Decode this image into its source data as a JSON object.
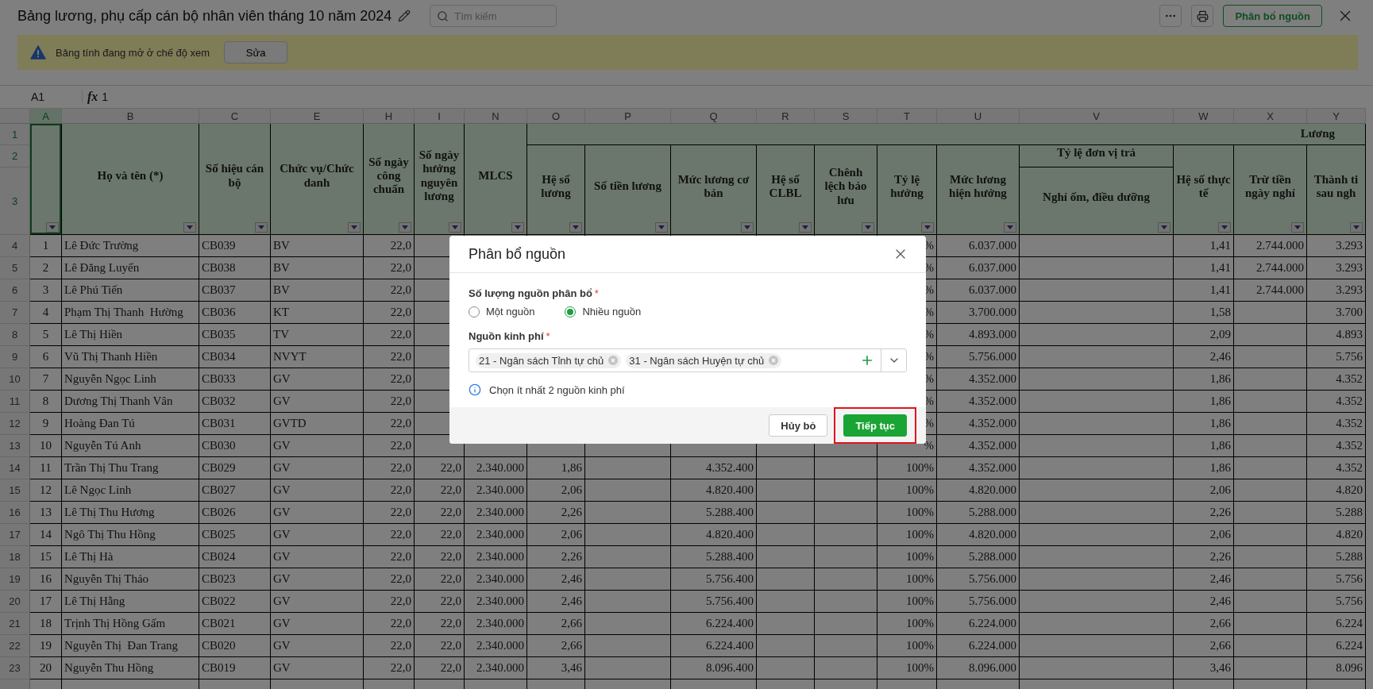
{
  "topbar": {
    "title": "Bảng lương, phụ cấp cán bộ nhân viên tháng 10 năm 2024",
    "search": {
      "placeholder": "Tìm kiếm"
    },
    "primary_button": "Phân bổ nguồn"
  },
  "banner": {
    "message": "Bảng tính đang mở ở chế độ xem",
    "button": "Sửa"
  },
  "formula_bar": {
    "cell_ref": "A1",
    "fx_label": "fx",
    "value": "1"
  },
  "sheet": {
    "band_title": "Lương",
    "header_rows": [
      {
        "label": "1",
        "selected": true
      },
      {
        "label": "2",
        "selected": true
      },
      {
        "label": "3",
        "selected": true
      }
    ],
    "columns": [
      {
        "letter": "A",
        "selected": true,
        "kind": "index",
        "banded": false
      },
      {
        "letter": "B",
        "selected": false,
        "kind": "text",
        "banded": false,
        "title": "Họ và tên (*)"
      },
      {
        "letter": "C",
        "selected": false,
        "kind": "text",
        "banded": false,
        "title": "Số hiệu cán bộ"
      },
      {
        "letter": "E",
        "selected": false,
        "kind": "text",
        "banded": false,
        "title": "Chức vụ/Chức danh"
      },
      {
        "letter": "H",
        "selected": false,
        "kind": "number",
        "banded": false,
        "title": "Số ngày công chuẩn"
      },
      {
        "letter": "I",
        "selected": false,
        "kind": "number",
        "banded": false,
        "title": "Số ngày hưởng nguyên lương"
      },
      {
        "letter": "N",
        "selected": false,
        "kind": "number",
        "banded": false,
        "title": "MLCS"
      },
      {
        "letter": "O",
        "selected": false,
        "kind": "number",
        "banded": true,
        "title": "Hệ số lương"
      },
      {
        "letter": "P",
        "selected": false,
        "kind": "number",
        "banded": true,
        "title": "Số tiền lương"
      },
      {
        "letter": "Q",
        "selected": false,
        "kind": "number",
        "banded": true,
        "title": "Mức lương cơ bản"
      },
      {
        "letter": "R",
        "selected": false,
        "kind": "number",
        "banded": true,
        "title": "Hệ số CLBL"
      },
      {
        "letter": "S",
        "selected": false,
        "kind": "number",
        "banded": true,
        "title": "Chênh lệch bảo lưu"
      },
      {
        "letter": "T",
        "selected": false,
        "kind": "number",
        "banded": true,
        "title": "Tỷ lệ hưởng"
      },
      {
        "letter": "U",
        "selected": false,
        "kind": "number",
        "banded": true,
        "title": "Mức lương hiện hưởng"
      },
      {
        "letter": "V",
        "selected": false,
        "kind": "number",
        "banded": true,
        "subgroup": "Tỷ lệ đơn vị trả",
        "title": "Nghỉ ốm, điều dưỡng"
      },
      {
        "letter": "W",
        "selected": false,
        "kind": "number",
        "banded": true,
        "title": "Hệ số thực tế"
      },
      {
        "letter": "X",
        "selected": false,
        "kind": "number",
        "banded": true,
        "title": "Trừ tiền ngày nghỉ"
      },
      {
        "letter": "Y",
        "selected": false,
        "kind": "number",
        "banded": true,
        "title": "Thành ti sau ngh"
      }
    ],
    "rows": [
      {
        "number": "4",
        "cells": [
          "1",
          "Lê Đức Trường",
          "CB039",
          "BV",
          "22,0",
          null,
          null,
          null,
          null,
          null,
          null,
          null,
          "%",
          "6.037.000",
          null,
          "1,41",
          "2.744.000",
          "3.293"
        ]
      },
      {
        "number": "5",
        "cells": [
          "2",
          "Lê Đăng Luyến",
          "CB038",
          "BV",
          "22,0",
          null,
          null,
          null,
          null,
          null,
          null,
          null,
          "%",
          "6.037.000",
          null,
          "1,41",
          "2.744.000",
          "3.293"
        ]
      },
      {
        "number": "6",
        "cells": [
          "3",
          "Lê Phú Tiến",
          "CB037",
          "BV",
          "22,0",
          null,
          null,
          null,
          null,
          null,
          null,
          null,
          "%",
          "6.037.000",
          null,
          "1,41",
          "2.744.000",
          "3.293"
        ]
      },
      {
        "number": "7",
        "cells": [
          "4",
          "Phạm Thị Thanh  Hường",
          "CB036",
          "KT",
          "22,0",
          null,
          null,
          null,
          null,
          null,
          null,
          null,
          "%",
          "3.700.000",
          null,
          "1,58",
          null,
          "3.700"
        ]
      },
      {
        "number": "8",
        "cells": [
          "5",
          "Lê Thị Hiền",
          "CB035",
          "TV",
          "22,0",
          null,
          null,
          null,
          null,
          null,
          null,
          null,
          "%",
          "4.893.000",
          null,
          "2,09",
          null,
          "4.893"
        ]
      },
      {
        "number": "9",
        "cells": [
          "6",
          "Vũ Thị Thanh Hiền",
          "CB034",
          "NVYT",
          "22,0",
          null,
          null,
          null,
          null,
          null,
          null,
          null,
          "%",
          "5.756.000",
          null,
          "2,46",
          null,
          "5.756"
        ]
      },
      {
        "number": "10",
        "cells": [
          "7",
          "Nguyễn Ngọc Linh",
          "CB033",
          "GV",
          "22,0",
          null,
          null,
          null,
          null,
          null,
          null,
          null,
          "%",
          "4.352.000",
          null,
          "1,86",
          null,
          "4.352"
        ]
      },
      {
        "number": "11",
        "cells": [
          "8",
          "Dương Thị Thanh Vân",
          "CB032",
          "GV",
          "22,0",
          null,
          null,
          null,
          null,
          null,
          null,
          null,
          "%",
          "4.352.000",
          null,
          "1,86",
          null,
          "4.352"
        ]
      },
      {
        "number": "12",
        "cells": [
          "9",
          "Hoàng Đan Tú",
          "CB031",
          "GVTD",
          "22,0",
          null,
          null,
          null,
          null,
          null,
          null,
          null,
          "%",
          "4.352.000",
          null,
          "1,86",
          null,
          "4.352"
        ]
      },
      {
        "number": "13",
        "cells": [
          "10",
          "Nguyễn Tú Anh",
          "CB030",
          "GV",
          "22,0",
          null,
          null,
          null,
          null,
          null,
          null,
          null,
          "%",
          "4.352.000",
          null,
          "1,86",
          null,
          "4.352"
        ]
      },
      {
        "number": "14",
        "cells": [
          "11",
          "Trần Thị Thu Trang",
          "CB029",
          "GV",
          "22,0",
          "22,0",
          "2.340.000",
          "1,86",
          null,
          "4.352.400",
          null,
          null,
          "100%",
          "4.352.000",
          null,
          "1,86",
          null,
          "4.352"
        ]
      },
      {
        "number": "15",
        "cells": [
          "12",
          "Lê Ngọc Linh",
          "CB027",
          "GV",
          "22,0",
          "22,0",
          "2.340.000",
          "2,06",
          null,
          "4.820.400",
          null,
          null,
          "100%",
          "4.820.000",
          null,
          "2,06",
          null,
          "4.820"
        ]
      },
      {
        "number": "16",
        "cells": [
          "13",
          "Lê Thị Thu Hương",
          "CB026",
          "GV",
          "22,0",
          "22,0",
          "2.340.000",
          "2,26",
          null,
          "5.288.400",
          null,
          null,
          "100%",
          "5.288.000",
          null,
          "2,26",
          null,
          "5.288"
        ]
      },
      {
        "number": "17",
        "cells": [
          "14",
          "Ngô Thị Thu Hồng",
          "CB025",
          "GV",
          "22,0",
          "22,0",
          "2.340.000",
          "2,06",
          null,
          "4.820.400",
          null,
          null,
          "100%",
          "4.820.000",
          null,
          "2,06",
          null,
          "4.820"
        ]
      },
      {
        "number": "18",
        "cells": [
          "15",
          "Lê Thị Hà",
          "CB024",
          "GV",
          "22,0",
          "22,0",
          "2.340.000",
          "2,26",
          null,
          "5.288.400",
          null,
          null,
          "100%",
          "5.288.000",
          null,
          "2,26",
          null,
          "5.288"
        ]
      },
      {
        "number": "19",
        "cells": [
          "16",
          "Nguyễn Thị Thảo",
          "CB023",
          "GV",
          "22,0",
          "22,0",
          "2.340.000",
          "2,46",
          null,
          "5.756.400",
          null,
          null,
          "100%",
          "5.756.000",
          null,
          "2,46",
          null,
          "5.756"
        ]
      },
      {
        "number": "20",
        "cells": [
          "17",
          "Lê Thị Hằng",
          "CB022",
          "GV",
          "22,0",
          "22,0",
          "2.340.000",
          "2,46",
          null,
          "5.756.400",
          null,
          null,
          "100%",
          "5.756.000",
          null,
          "2,46",
          null,
          "5.756"
        ]
      },
      {
        "number": "21",
        "cells": [
          "18",
          "Trịnh Thị Hồng Gấm",
          "CB021",
          "GV",
          "22,0",
          "22,0",
          "2.340.000",
          "2,66",
          null,
          "6.224.400",
          null,
          null,
          "100%",
          "6.224.000",
          null,
          "2,66",
          null,
          "6.224"
        ]
      },
      {
        "number": "22",
        "cells": [
          "19",
          "Nguyễn Thị  Đan Trang",
          "CB020",
          "GV",
          "22,0",
          "22,0",
          "2.340.000",
          "2,66",
          null,
          "6.224.400",
          null,
          null,
          "100%",
          "6.224.000",
          null,
          "2,66",
          null,
          "6.224"
        ]
      },
      {
        "number": "23",
        "cells": [
          "20",
          "Nguyễn Thu Hồng",
          "CB019",
          "GV",
          "22,0",
          "22,0",
          "2.340.000",
          "3,46",
          null,
          "8.096.400",
          null,
          null,
          "100%",
          "8.096.000",
          null,
          "3,46",
          null,
          "8.096"
        ]
      }
    ]
  },
  "dialog": {
    "title": "Phân bổ nguồn",
    "fields": [
      {
        "kind": "radio",
        "label": "Số lượng nguồn phân bổ",
        "required_mark": "*",
        "options": [
          {
            "label": "Một nguồn",
            "selected": false
          },
          {
            "label": "Nhiều nguồn",
            "selected": true
          }
        ]
      },
      {
        "kind": "multiselect",
        "label": "Nguồn kinh phí",
        "required_mark": "*",
        "tags": [
          "21 - Ngân sách Tỉnh tự chủ",
          "31 - Ngân sách Huyện tự chủ"
        ]
      }
    ],
    "hint": "Chọn ít nhất 2 nguồn kinh phí",
    "buttons": [
      {
        "label": "Hủy bỏ",
        "kind": "secondary",
        "highlighted": false
      },
      {
        "label": "Tiếp tục",
        "kind": "primary",
        "highlighted": true
      }
    ]
  }
}
